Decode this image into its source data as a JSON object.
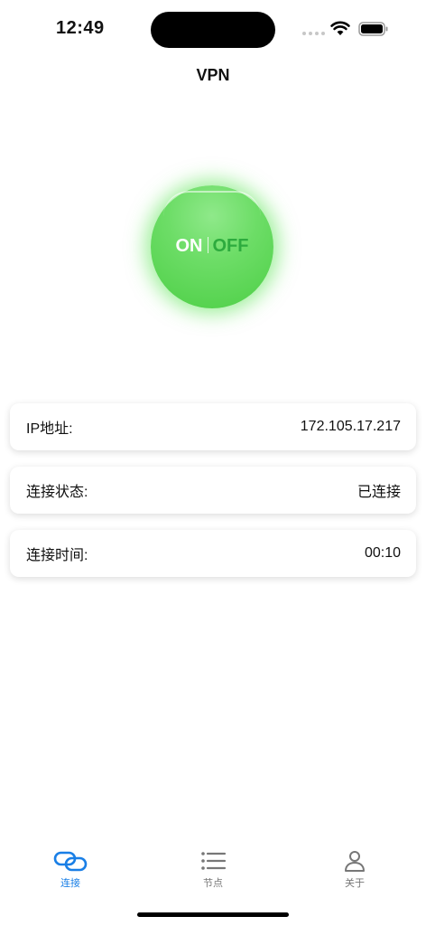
{
  "status_bar": {
    "time": "12:49",
    "icons": [
      "signal-dots-icon",
      "wifi-icon",
      "battery-icon"
    ]
  },
  "nav": {
    "title": "VPN"
  },
  "toggle": {
    "on_label": "ON",
    "off_label": "OFF",
    "active_color": "#4dcf46",
    "off_label_color": "#2dab3e"
  },
  "info": {
    "ip": {
      "label": "IP地址:",
      "value": "172.105.17.217"
    },
    "status": {
      "label": "连接状态:",
      "value": "已连接"
    },
    "duration": {
      "label": "连接时间:",
      "value": "00:10"
    }
  },
  "tabs": [
    {
      "label": "连接",
      "icon": "link-icon",
      "active": true
    },
    {
      "label": "节点",
      "icon": "list-icon",
      "active": false
    },
    {
      "label": "关于",
      "icon": "person-icon",
      "active": false
    }
  ],
  "colors": {
    "accent": "#1a7fe6",
    "inactive": "#777777"
  }
}
